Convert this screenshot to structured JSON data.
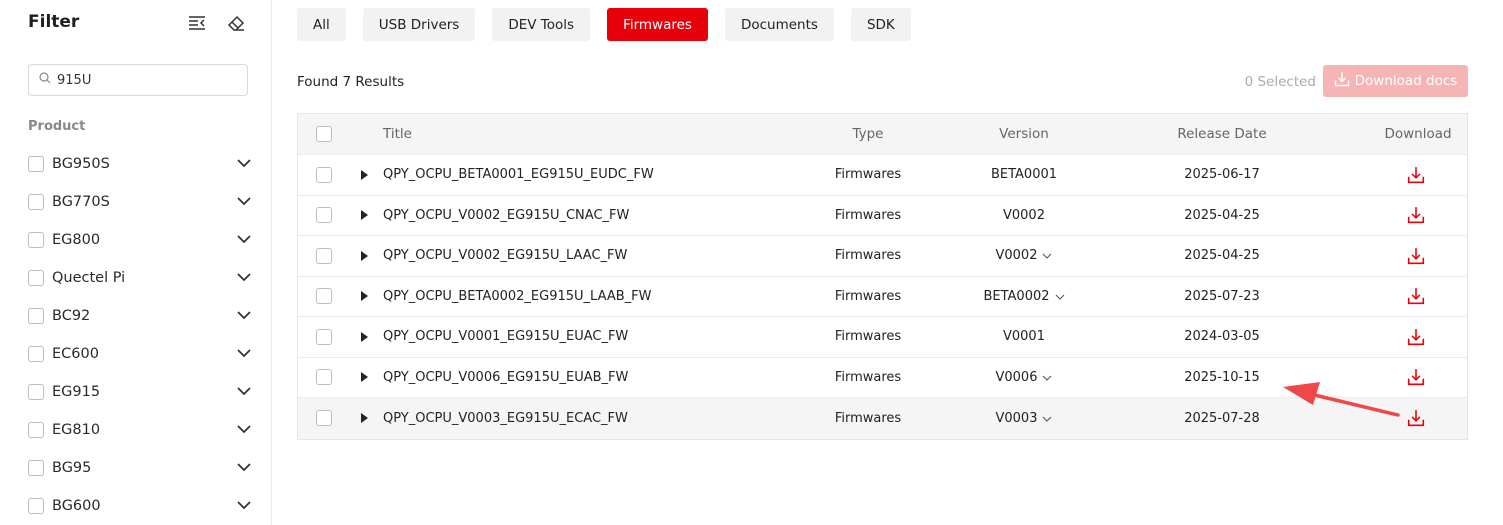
{
  "sidebar": {
    "title": "Filter",
    "search": {
      "value": "915U",
      "placeholder": ""
    },
    "section_label": "Product",
    "products": [
      "BG950S",
      "BG770S",
      "EG800",
      "Quectel Pi",
      "BC92",
      "EC600",
      "EG915",
      "EG810",
      "BG95",
      "BG600"
    ]
  },
  "tabs": [
    "All",
    "USB Drivers",
    "DEV Tools",
    "Firmwares",
    "Documents",
    "SDK"
  ],
  "active_tab": "Firmwares",
  "results_text": "Found 7 Results",
  "selected_text": "0 Selected",
  "download_docs_label": "Download docs",
  "table": {
    "headers": {
      "title": "Title",
      "type": "Type",
      "version": "Version",
      "release_date": "Release Date",
      "download": "Download"
    },
    "rows": [
      {
        "title": "QPY_OCPU_BETA0001_EG915U_EUDC_FW",
        "type": "Firmwares",
        "version": "BETA0001",
        "has_versions": false,
        "date": "2025-06-17"
      },
      {
        "title": "QPY_OCPU_V0002_EG915U_CNAC_FW",
        "type": "Firmwares",
        "version": "V0002",
        "has_versions": false,
        "date": "2025-04-25"
      },
      {
        "title": "QPY_OCPU_V0002_EG915U_LAAC_FW",
        "type": "Firmwares",
        "version": "V0002",
        "has_versions": true,
        "date": "2025-04-25"
      },
      {
        "title": "QPY_OCPU_BETA0002_EG915U_LAAB_FW",
        "type": "Firmwares",
        "version": "BETA0002",
        "has_versions": true,
        "date": "2025-07-23"
      },
      {
        "title": "QPY_OCPU_V0001_EG915U_EUAC_FW",
        "type": "Firmwares",
        "version": "V0001",
        "has_versions": false,
        "date": "2024-03-05"
      },
      {
        "title": "QPY_OCPU_V0006_EG915U_EUAB_FW",
        "type": "Firmwares",
        "version": "V0006",
        "has_versions": true,
        "date": "2025-10-15"
      },
      {
        "title": "QPY_OCPU_V0003_EG915U_ECAC_FW",
        "type": "Firmwares",
        "version": "V0003",
        "has_versions": true,
        "date": "2025-07-28"
      }
    ]
  },
  "colors": {
    "accent": "#e8000b",
    "accent_disabled": "#f7b4b4",
    "annotation": "#f04848"
  }
}
